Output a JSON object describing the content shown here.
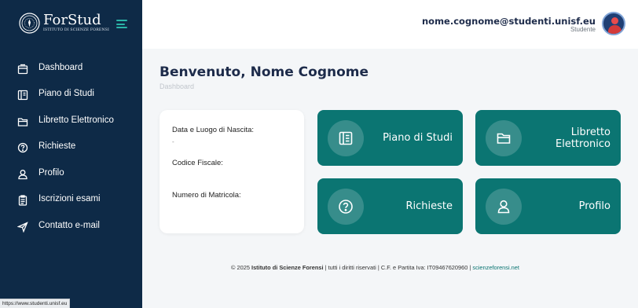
{
  "brand": {
    "name": "ForStud",
    "subtitle": "ISTITUTO DI SCIENZE FORENSI"
  },
  "sidebar": {
    "items": [
      {
        "label": "Dashboard",
        "icon": "dashboard-icon"
      },
      {
        "label": "Piano di Studi",
        "icon": "book-icon"
      },
      {
        "label": "Libretto Elettronico",
        "icon": "folder-icon"
      },
      {
        "label": "Richieste",
        "icon": "question-icon"
      },
      {
        "label": "Profilo",
        "icon": "user-icon"
      },
      {
        "label": "Iscrizioni esami",
        "icon": "clipboard-icon"
      },
      {
        "label": "Contatto e-mail",
        "icon": "send-icon"
      }
    ]
  },
  "header": {
    "email": "nome.cognome@studenti.unisf.eu",
    "role": "Studente"
  },
  "main": {
    "title": "Benvenuto, Nome Cognome",
    "breadcrumb": "Dashboard"
  },
  "info": {
    "birth_label": "Data e Luogo di Nascita:",
    "birth_value": "-",
    "fiscal_code_label": "Codice Fiscale:",
    "matricola_label": "Numero di Matricola:"
  },
  "tiles": [
    {
      "lines": [
        "Piano di Studi"
      ],
      "icon": "book-icon"
    },
    {
      "lines": [
        "Libretto",
        "Elettronico"
      ],
      "icon": "folder-icon"
    },
    {
      "lines": [
        "Richieste"
      ],
      "icon": "question-icon"
    },
    {
      "lines": [
        "Profilo"
      ],
      "icon": "user-icon"
    }
  ],
  "footer": {
    "prefix": "© 2025 ",
    "org": "Istituto di Scienze Forensi",
    "rights": " | tutti i diritti riservati | C.F. e Partita Iva: IT09467620960 | ",
    "link": "scienzeforensi.net"
  },
  "status_bar": {
    "url": "https://www.studenti.unisf.eu"
  },
  "colors": {
    "sidebar": "#0e2a47",
    "accent": "#0b7572",
    "hamburger": "#2ab5a8",
    "title": "#1d2b4a"
  }
}
